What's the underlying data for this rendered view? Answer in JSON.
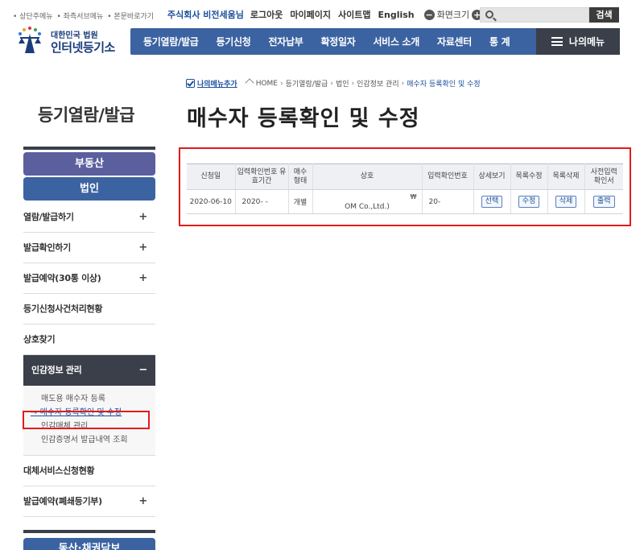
{
  "skip_links": [
    "• 상단주메뉴",
    "• 좌측서브메뉴",
    "• 본문바로가기"
  ],
  "util": {
    "company_user": "주식회사 비전세움님",
    "logout": "로그아웃",
    "mypage": "마이페이지",
    "sitemap": "사이트맵",
    "english": "English",
    "font_minus": "−",
    "font_label": "화면크기",
    "font_plus": "+",
    "search_placeholder": "",
    "search_button": "검색"
  },
  "logo": {
    "sub": "대한민국 법원",
    "main": "인터넷등기소"
  },
  "gnb": {
    "items": [
      "등기열람/발급",
      "등기신청",
      "전자납부",
      "확정일자",
      "서비스 소개",
      "자료센터",
      "통 계"
    ],
    "my_menu": "나의메뉴"
  },
  "breadcrumb": {
    "my_add": "나의메뉴추가",
    "home": "HOME",
    "items": [
      "등기열람/발급",
      "법인",
      "인감정보 관리"
    ],
    "current": "매수자 등록확인 및 수정"
  },
  "section_title": "등기열람/발급",
  "page_title": "매수자 등록확인 및 수정",
  "sidebar": {
    "cat_realty": "부동산",
    "cat_corp": "법인",
    "items": [
      {
        "label": "열람/발급하기",
        "plus": "+"
      },
      {
        "label": "발급확인하기",
        "plus": "+"
      },
      {
        "label": "발급예약(30통 이상)",
        "plus": "+"
      },
      {
        "label": "등기신청사건처리현황",
        "plus": ""
      },
      {
        "label": "상호찾기",
        "plus": ""
      }
    ],
    "active": {
      "label": "인감정보 관리",
      "minus": "−"
    },
    "sub_items": [
      "매도용 매수자 등록",
      "매수자 등록확인 및 수정",
      "인감매체 관리",
      "인감증명서 발급내역 조회"
    ],
    "items_after": [
      {
        "label": "대체서비스신청현황",
        "plus": ""
      },
      {
        "label": "발급예약(폐쇄등기부)",
        "plus": "+"
      }
    ],
    "bottom_cat": "동산·채권담보"
  },
  "table": {
    "headers": [
      "신청일",
      "입력확인번호 유효기간",
      "매수 형태",
      "상호",
      "입력확인번호",
      "상세보기",
      "목록수정",
      "목록삭제",
      "사전입력 확인서"
    ],
    "rows": [
      {
        "date": "2020-06-10",
        "validity": "2020-   -",
        "type": "개별",
        "company_symbol": "₩",
        "company": "OM Co.,Ltd.)",
        "confirm_no": "20-",
        "btn_view": "선택",
        "btn_edit": "수정",
        "btn_delete": "삭제",
        "btn_print": "출력"
      }
    ]
  }
}
